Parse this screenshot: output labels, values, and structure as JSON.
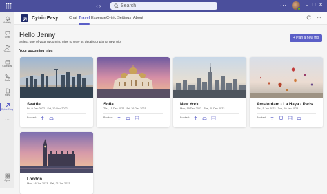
{
  "topbar": {
    "search_placeholder": "Search",
    "more_label": "···",
    "window_controls": [
      "–",
      "□",
      "✕"
    ],
    "nav_back": "‹",
    "nav_forward": "›"
  },
  "rail": {
    "items": [
      {
        "label": "Activity",
        "icon": "bell-icon"
      },
      {
        "label": "Chat",
        "icon": "chat-icon"
      },
      {
        "label": "Teams",
        "icon": "teams-icon"
      },
      {
        "label": "Calendar",
        "icon": "calendar-icon"
      },
      {
        "label": "Calls",
        "icon": "phone-icon"
      },
      {
        "label": "Files",
        "icon": "file-icon"
      },
      {
        "label": "Cytric Easy",
        "icon": "app-icon",
        "active": true
      },
      {
        "label": "···",
        "icon": "more-icon"
      },
      {
        "label": "Apps",
        "icon": "apps-icon"
      }
    ]
  },
  "app": {
    "name": "Cytric Easy",
    "tabs": [
      "Chat",
      "Travel",
      "Expense",
      "Cytric",
      "Settings",
      "About"
    ],
    "active_tab": "Travel"
  },
  "main": {
    "greeting": "Hello Jenny",
    "subtitle": "Select one of your upcoming trips to view its details or plan a new trip.",
    "section_title": "Your upcoming trips",
    "plan_button": "+ Plan a new trip",
    "booked_label": "Booked:"
  },
  "trips": [
    {
      "city": "Seattle",
      "dates": "Fri, 9 Dec 2022 - Sat, 10 Dec 2022",
      "image": "seattle-skyline-photo"
    },
    {
      "city": "Sofia",
      "dates": "Thu, 15 Dec 2022 - Fri, 16 Dec 2021",
      "image": "sofia-cathedral-photo"
    },
    {
      "city": "New York",
      "dates": "Mon, 19 Dec 2022 - Tue, 20 Dec 2022",
      "image": "new-york-skyline-photo"
    },
    {
      "city": "Amsterdam - La Haya - Paris",
      "dates": "Thu, 5 Jan 2023 - Tue, 10 Jan 2023",
      "image": "hot-air-balloons-photo"
    },
    {
      "city": "London",
      "dates": "Mon, 16 Jan 2023 - Sat, 21 Jan 2023",
      "image": "london-big-ben-photo"
    }
  ],
  "colors": {
    "topbar": "#4b4f9c",
    "accent": "#5b5fc7",
    "app_logo": "#1f2a69"
  }
}
